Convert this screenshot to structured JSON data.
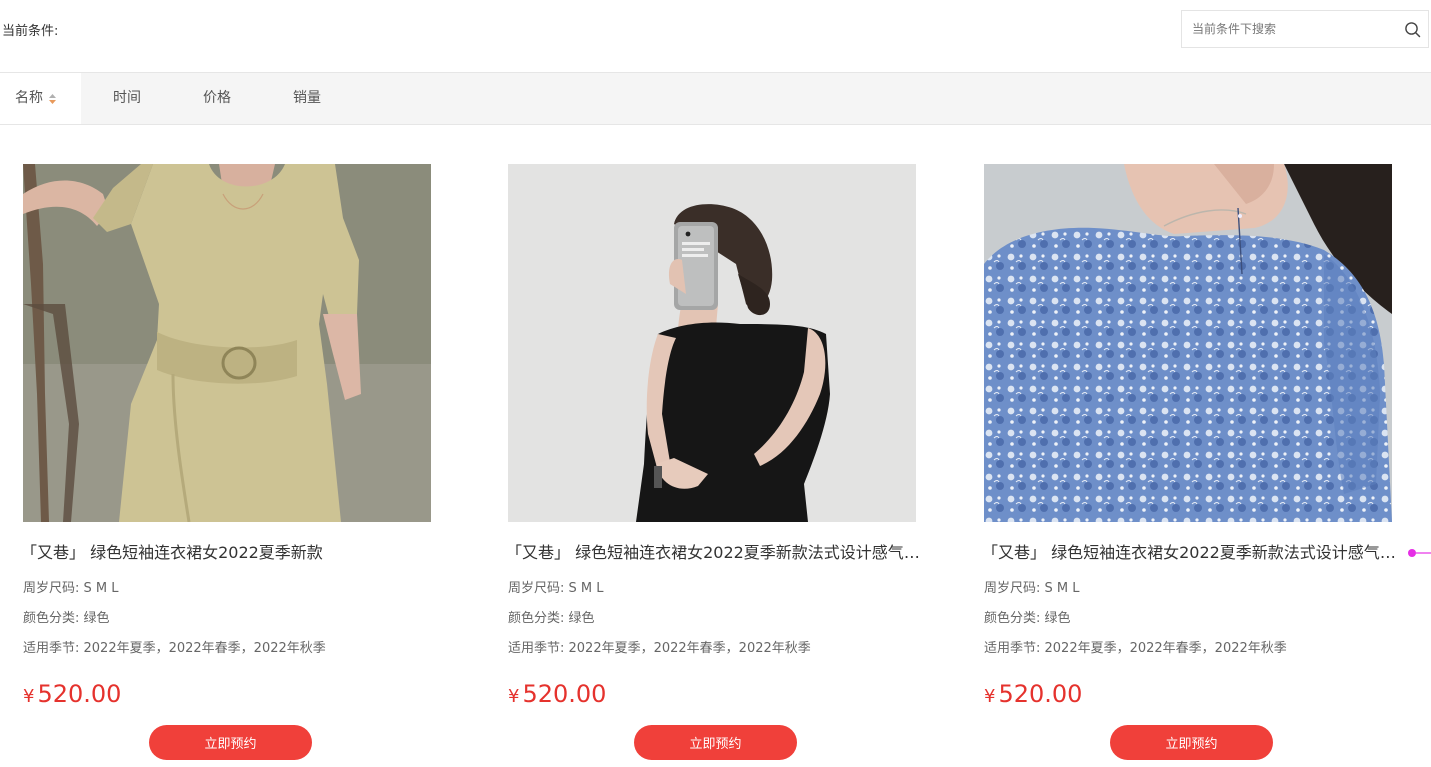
{
  "filter": {
    "condition_label": "当前条件:",
    "search_placeholder": "当前条件下搜索"
  },
  "sort_tabs": [
    {
      "label": "名称",
      "active": true
    },
    {
      "label": "时间"
    },
    {
      "label": "价格"
    },
    {
      "label": "销量"
    }
  ],
  "products": [
    {
      "title": "「又巷」 绿色短袖连衣裙女2022夏季新款",
      "size": "周岁尺码: S M L",
      "color": "颜色分类: 绿色",
      "season": "适用季节: 2022年夏季，2022年春季，2022年秋季",
      "currency": "¥",
      "price": "520.00",
      "button": "立即预约"
    },
    {
      "title": "「又巷」 绿色短袖连衣裙女2022夏季新款法式设计感气质...",
      "size": "周岁尺码: S M L",
      "color": "颜色分类: 绿色",
      "season": "适用季节: 2022年夏季，2022年春季，2022年秋季",
      "currency": "¥",
      "price": "520.00",
      "button": "立即预约"
    },
    {
      "title": "「又巷」 绿色短袖连衣裙女2022夏季新款法式设计感气质...",
      "size": "周岁尺码: S M L",
      "color": "颜色分类: 绿色",
      "season": "适用季节: 2022年夏季，2022年春季，2022年秋季",
      "currency": "¥",
      "price": "520.00",
      "button": "立即预约"
    }
  ],
  "colors": {
    "price_red": "#e5322d",
    "button_red": "#f0403a",
    "accent_magenta": "#e62ee6"
  }
}
